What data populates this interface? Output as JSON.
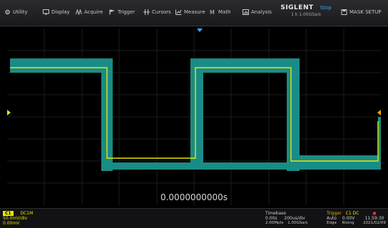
{
  "menu": {
    "items": [
      {
        "label": "Utility",
        "icon": "gear-icon"
      },
      {
        "label": "Display",
        "icon": "display-icon"
      },
      {
        "label": "Acquire",
        "icon": "acquire-icon"
      },
      {
        "label": "Trigger",
        "icon": "trigger-icon"
      },
      {
        "label": "Cursors",
        "icon": "cursors-icon"
      },
      {
        "label": "Measure",
        "icon": "measure-icon"
      },
      {
        "label": "Math",
        "icon": "math-icon"
      },
      {
        "label": "Analysis",
        "icon": "analysis-icon"
      }
    ],
    "mask_setup": "MASK SETUP"
  },
  "brand": {
    "name": "SIGLENT",
    "mode": "Stop",
    "sample_rate": "1 k 1.00GSa/s"
  },
  "waveform": {
    "color": "#e6e600",
    "mask_color": "#1a8c86",
    "cursor_time": "0.0000000000s"
  },
  "ch1": {
    "label": "C1",
    "coupling": "DC1M",
    "scale": "50.0mV/div",
    "offset": "0.00mV"
  },
  "timebase": {
    "title": "Timebase",
    "delay": "0.00s",
    "scale": "200us/div",
    "memory": "2.00Mpts",
    "rate": "1.00GSa/s"
  },
  "trigger": {
    "title": "Trigger",
    "channel": "C1 DC",
    "mode": "Auto",
    "level": "0.00V",
    "type": "Edge",
    "slope": "Rising"
  },
  "clock": {
    "time": "11:59:30",
    "date": "2021/02/09"
  }
}
